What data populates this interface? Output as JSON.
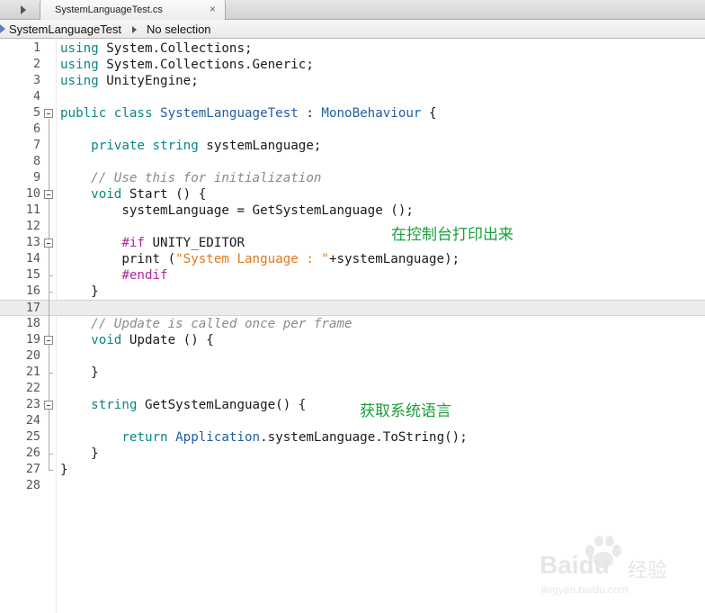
{
  "tab": {
    "title": "SystemLanguageTest.cs",
    "close_glyph": "×"
  },
  "breadcrumb": {
    "class_name": "SystemLanguageTest",
    "member": "No selection"
  },
  "code_lines": [
    {
      "n": "1",
      "t": [
        [
          "kw",
          "using"
        ],
        [
          "plain",
          " System.Collections;"
        ]
      ]
    },
    {
      "n": "2",
      "t": [
        [
          "kw",
          "using"
        ],
        [
          "plain",
          " System.Collections.Generic;"
        ]
      ]
    },
    {
      "n": "3",
      "t": [
        [
          "kw",
          "using"
        ],
        [
          "plain",
          " UnityEngine;"
        ]
      ]
    },
    {
      "n": "4",
      "t": []
    },
    {
      "n": "5",
      "t": [
        [
          "kw",
          "public class"
        ],
        [
          "plain",
          " "
        ],
        [
          "ty",
          "SystemLanguageTest"
        ],
        [
          "plain",
          " : "
        ],
        [
          "ty",
          "MonoBehaviour"
        ],
        [
          "plain",
          " {"
        ]
      ]
    },
    {
      "n": "6",
      "t": []
    },
    {
      "n": "7",
      "t": [
        [
          "plain",
          "    "
        ],
        [
          "kw",
          "private string"
        ],
        [
          "plain",
          " systemLanguage;"
        ]
      ]
    },
    {
      "n": "8",
      "t": []
    },
    {
      "n": "9",
      "t": [
        [
          "plain",
          "    "
        ],
        [
          "cm",
          "// Use this for initialization"
        ]
      ]
    },
    {
      "n": "10",
      "t": [
        [
          "plain",
          "    "
        ],
        [
          "kw",
          "void"
        ],
        [
          "plain",
          " Start () {"
        ]
      ]
    },
    {
      "n": "11",
      "t": [
        [
          "plain",
          "        systemLanguage = GetSystemLanguage ();"
        ]
      ]
    },
    {
      "n": "12",
      "t": []
    },
    {
      "n": "13",
      "t": [
        [
          "plain",
          "        "
        ],
        [
          "pp",
          "#if"
        ],
        [
          "plain",
          " UNITY_EDITOR"
        ]
      ]
    },
    {
      "n": "14",
      "t": [
        [
          "plain",
          "        print ("
        ],
        [
          "st",
          "\"System Language : \""
        ],
        [
          "plain",
          "+systemLanguage);"
        ]
      ]
    },
    {
      "n": "15",
      "t": [
        [
          "plain",
          "        "
        ],
        [
          "pp",
          "#endif"
        ]
      ]
    },
    {
      "n": "16",
      "t": [
        [
          "plain",
          "    }"
        ]
      ]
    },
    {
      "n": "17",
      "t": []
    },
    {
      "n": "18",
      "t": [
        [
          "plain",
          "    "
        ],
        [
          "cm",
          "// Update is called once per frame"
        ]
      ]
    },
    {
      "n": "19",
      "t": [
        [
          "plain",
          "    "
        ],
        [
          "kw",
          "void"
        ],
        [
          "plain",
          " Update () {"
        ]
      ]
    },
    {
      "n": "20",
      "t": []
    },
    {
      "n": "21",
      "t": [
        [
          "plain",
          "    }"
        ]
      ]
    },
    {
      "n": "22",
      "t": []
    },
    {
      "n": "23",
      "t": [
        [
          "plain",
          "    "
        ],
        [
          "kw",
          "string"
        ],
        [
          "plain",
          " GetSystemLanguage() {"
        ]
      ]
    },
    {
      "n": "24",
      "t": []
    },
    {
      "n": "25",
      "t": [
        [
          "plain",
          "        "
        ],
        [
          "kw",
          "return"
        ],
        [
          "plain",
          " "
        ],
        [
          "ty",
          "Application"
        ],
        [
          "plain",
          ".systemLanguage.ToString();"
        ]
      ]
    },
    {
      "n": "26",
      "t": [
        [
          "plain",
          "    }"
        ]
      ]
    },
    {
      "n": "27",
      "t": [
        [
          "plain",
          "}"
        ]
      ]
    },
    {
      "n": "28",
      "t": []
    }
  ],
  "current_line": "17",
  "annotations": {
    "print_to_console": "在控制台打印出来",
    "get_system_language": "获取系统语言"
  },
  "watermark": {
    "brand": "Baidu",
    "suffix": "经验",
    "url": "jingyan.baidu.com"
  },
  "colors": {
    "keyword": "#0b8584",
    "type": "#1f5ea1",
    "comment": "#8a8a8a",
    "string": "#e07a1d",
    "preprocessor": "#b0259b",
    "annotation": "#1aa03a"
  }
}
